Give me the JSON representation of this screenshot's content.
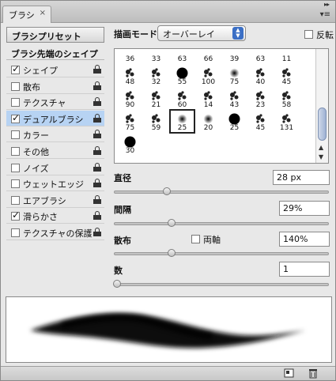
{
  "tab": {
    "label": "ブラシ",
    "close": "×"
  },
  "left": {
    "preset_button": "ブラシプリセット",
    "section_head": "ブラシ先端のシェイプ",
    "options": [
      {
        "label": "シェイプ",
        "checked": true,
        "selected": false,
        "locked": true
      },
      {
        "label": "散布",
        "checked": false,
        "selected": false,
        "locked": true
      },
      {
        "label": "テクスチャ",
        "checked": false,
        "selected": false,
        "locked": true
      },
      {
        "label": "デュアルブラシ",
        "checked": true,
        "selected": true,
        "locked": true
      },
      {
        "label": "カラー",
        "checked": false,
        "selected": false,
        "locked": true
      },
      {
        "label": "その他",
        "checked": false,
        "selected": false,
        "locked": true
      },
      {
        "label": "ノイズ",
        "checked": false,
        "selected": false,
        "locked": true
      },
      {
        "label": "ウェットエッジ",
        "checked": false,
        "selected": false,
        "locked": true
      },
      {
        "label": "エアブラシ",
        "checked": false,
        "selected": false,
        "locked": true
      },
      {
        "label": "滑らかさ",
        "checked": true,
        "selected": false,
        "locked": true
      },
      {
        "label": "テクスチャの保護",
        "checked": false,
        "selected": false,
        "locked": true
      }
    ]
  },
  "mode": {
    "label": "描画モード :",
    "value": "オーバーレイ",
    "invert_label": "反転"
  },
  "brushes": {
    "rows": [
      [
        "36",
        "33",
        "63",
        "66",
        "39",
        "63",
        "11"
      ],
      [
        "48",
        "32",
        "55",
        "100",
        "75",
        "40",
        "45"
      ],
      [
        "90",
        "21",
        "60",
        "14",
        "43",
        "23",
        "58"
      ],
      [
        "75",
        "59",
        "25",
        "20",
        "25",
        "45",
        "131"
      ],
      [
        "30"
      ]
    ],
    "selected": "25"
  },
  "params": {
    "diameter": {
      "label": "直径",
      "value": "28 px",
      "slider": 0.12
    },
    "spacing": {
      "label": "間隔",
      "value": "29%",
      "slider": 0.14
    },
    "scatter": {
      "label": "散布",
      "both_axes": "両軸",
      "value": "140%",
      "slider": 0.14
    },
    "count": {
      "label": "数",
      "value": "1",
      "slider": 0.0
    }
  }
}
